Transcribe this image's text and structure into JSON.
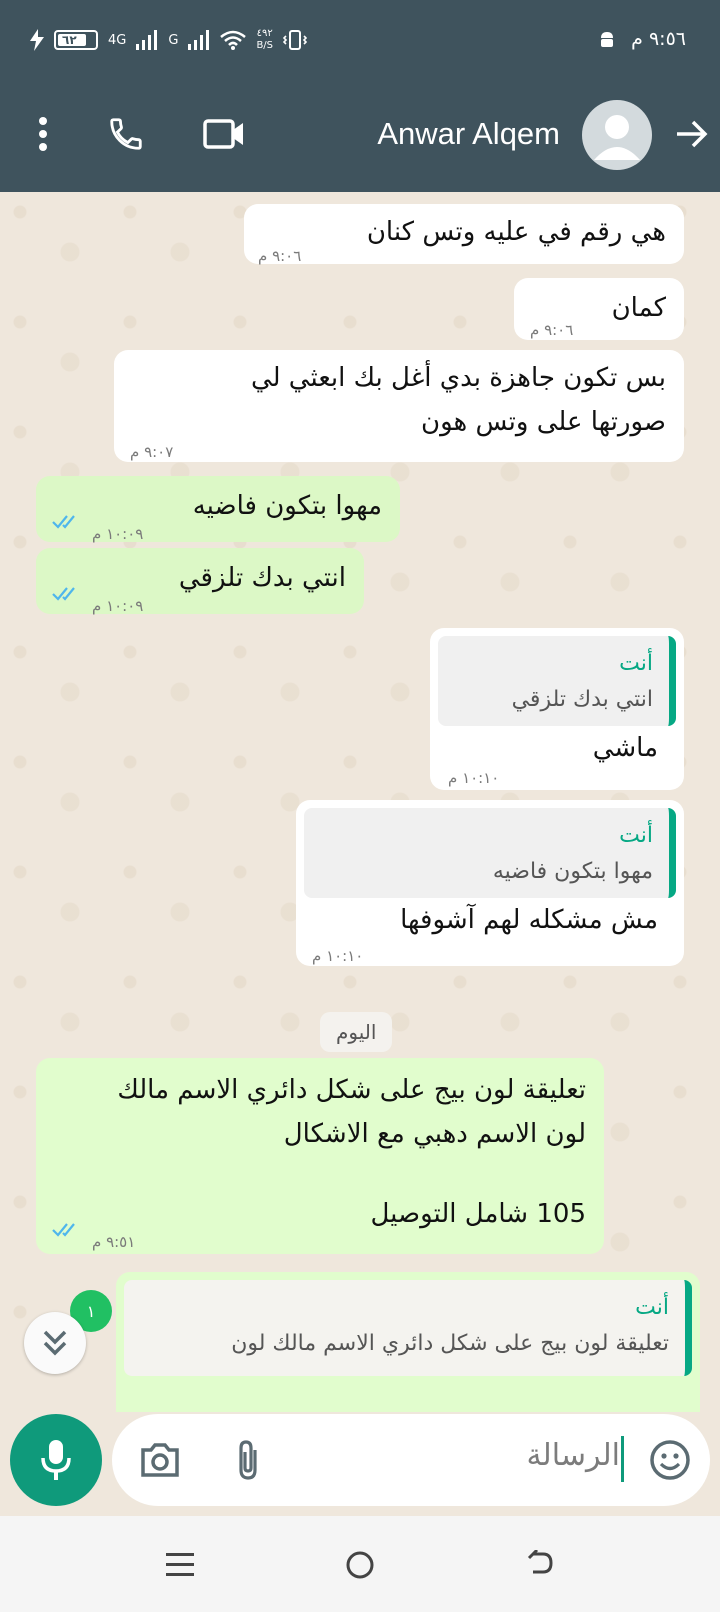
{
  "status_bar": {
    "time": "٩:٥٦ م",
    "battery": "٦٢",
    "network_4g": "4G",
    "network_g": "G",
    "speed_value": "٤٩٢",
    "speed_unit": "B/S"
  },
  "header": {
    "contact_name": "Anwar Alqem"
  },
  "messages": [
    {
      "text": "هي رقم في عليه وتس كنان",
      "time": "٩:٠٦ م"
    },
    {
      "text": "كمان",
      "time": "٩:٠٦ م"
    },
    {
      "text": "بس تكون جاهزة بدي أغل بك ابعثي لي صورتها على وتس هون",
      "time": "٩:٠٧ م"
    },
    {
      "text": "مهوا بتكون فاضيه",
      "time": "١٠:٠٩ م"
    },
    {
      "text": "انتي بدك تلزقي",
      "time": "١٠:٠٩ م"
    },
    {
      "quote_name": "أنت",
      "quote_text": "انتي بدك تلزقي",
      "text": "ماشي",
      "time": "١٠:١٠ م"
    },
    {
      "quote_name": "أنت",
      "quote_text": "مهوا بتكون فاضيه",
      "text": "مش مشكله لهم آشوفها",
      "time": "١٠:١٠ م"
    },
    {
      "text_line1": "تعليقة لون بيج على شكل دائري الاسم مالك",
      "text_line2": "لون الاسم دهبي مع الاشكال",
      "text_line3": "105 شامل التوصيل",
      "time": "٩:٥١ م"
    },
    {
      "quote_name": "أنت",
      "quote_text": "تعليقة لون بيج على شكل دائري الاسم مالك لون"
    }
  ],
  "day_chip": "اليوم",
  "unread_count": "١",
  "input": {
    "placeholder": "الرسالة"
  },
  "icons": [
    "more-vert-icon",
    "phone-icon",
    "video-icon",
    "back-arrow-icon",
    "emoji-icon",
    "attach-icon",
    "camera-icon",
    "mic-icon",
    "chevron-double-down-icon"
  ],
  "colors": {
    "header": "#3f535d",
    "accent": "#0f9a7b",
    "outgoing_bubble": "#dcf8c6",
    "incoming_bubble": "#ffffff",
    "read_ticks": "#4fb6ec"
  }
}
